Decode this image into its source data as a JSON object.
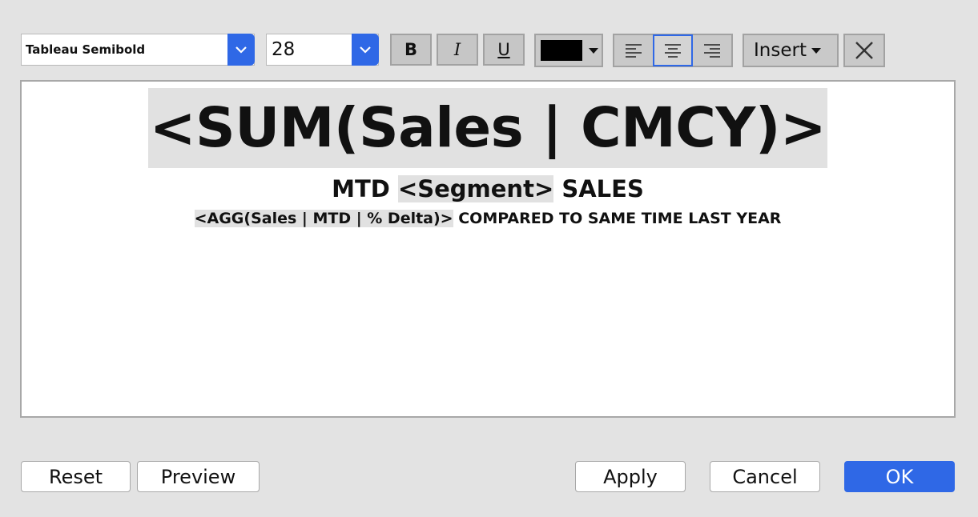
{
  "toolbar": {
    "font_family": "Tableau Semibold",
    "font_size": "28",
    "bold_label": "B",
    "italic_label": "I",
    "underline_label": "U",
    "text_color": "#000000",
    "alignment_selected": "center",
    "insert_label": "Insert"
  },
  "editor": {
    "line1": {
      "field": "<SUM(Sales | CMCY)>"
    },
    "line2": {
      "prefix": "MTD ",
      "field": "<Segment>",
      "suffix": " SALES"
    },
    "line3": {
      "field": "<AGG(Sales | MTD | % Delta)>",
      "suffix": " COMPARED TO SAME TIME LAST YEAR"
    }
  },
  "buttons": {
    "reset": "Reset",
    "preview": "Preview",
    "apply": "Apply",
    "cancel": "Cancel",
    "ok": "OK"
  },
  "colors": {
    "accent": "#2f68e6",
    "field_highlight": "#e1e1e1",
    "background": "#e3e3e3"
  }
}
